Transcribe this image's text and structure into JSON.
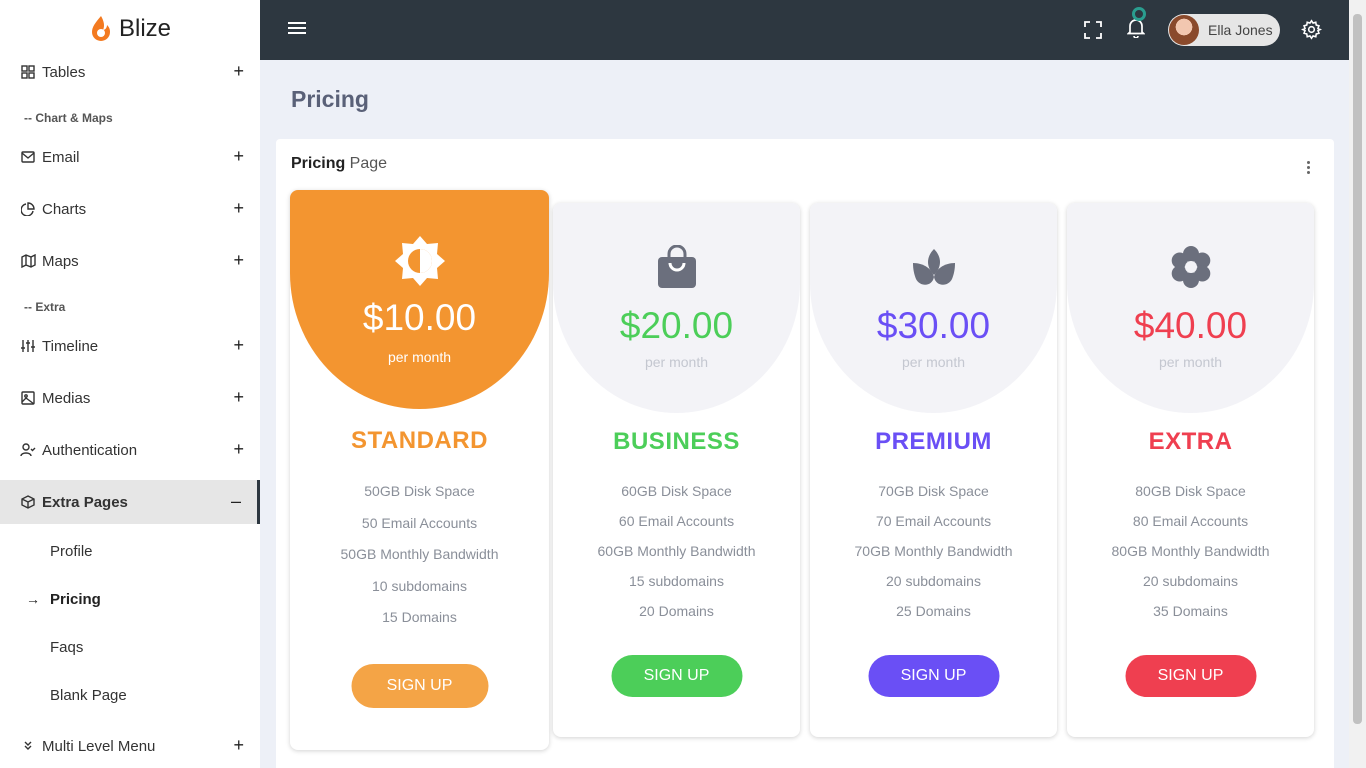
{
  "brand": {
    "name": "Blize"
  },
  "sidebar": {
    "items": [
      {
        "label": "Tables",
        "icon": "grid-icon",
        "toggle": "+"
      },
      {
        "label": "Email",
        "icon": "mail-icon",
        "toggle": "+"
      },
      {
        "label": "Charts",
        "icon": "pie-chart-icon",
        "toggle": "+"
      },
      {
        "label": "Maps",
        "icon": "map-icon",
        "toggle": "+"
      },
      {
        "label": "Timeline",
        "icon": "sliders-icon",
        "toggle": "+"
      },
      {
        "label": "Medias",
        "icon": "image-icon",
        "toggle": "+"
      },
      {
        "label": "Authentication",
        "icon": "user-check-icon",
        "toggle": "+"
      },
      {
        "label": "Extra Pages",
        "icon": "box-icon",
        "toggle": "–"
      },
      {
        "label": "Multi Level Menu",
        "icon": "chevrons-down-icon",
        "toggle": "+"
      }
    ],
    "sections": [
      "-- Chart & Maps",
      "-- Extra"
    ],
    "sub_items": [
      "Profile",
      "Pricing",
      "Faqs",
      "Blank Page"
    ]
  },
  "topbar": {
    "user_name": "Ella Jones"
  },
  "page": {
    "title": "Pricing",
    "card_title_bold": "Pricing",
    "card_title_rest": " Page"
  },
  "plans": [
    {
      "price": "$10.00",
      "per": "per month",
      "name": "STANDARD",
      "color": "#f39530",
      "features": [
        "50GB Disk Space",
        "50 Email Accounts",
        "50GB Monthly Bandwidth",
        "10 subdomains",
        "15 Domains"
      ],
      "button": "SIGN UP",
      "icon": "brightness-icon",
      "featured": true
    },
    {
      "price": "$20.00",
      "per": "per month",
      "name": "BUSINESS",
      "color": "#4cce59",
      "features": [
        "60GB Disk Space",
        "60 Email Accounts",
        "60GB Monthly Bandwidth",
        "15 subdomains",
        "20 Domains"
      ],
      "button": "SIGN UP",
      "icon": "shopping-bag-icon",
      "featured": false
    },
    {
      "price": "$30.00",
      "per": "per month",
      "name": "PREMIUM",
      "color": "#6a4ff5",
      "features": [
        "70GB Disk Space",
        "70 Email Accounts",
        "70GB Monthly Bandwidth",
        "20 subdomains",
        "25 Domains"
      ],
      "button": "SIGN UP",
      "icon": "lotus-icon",
      "featured": false
    },
    {
      "price": "$40.00",
      "per": "per month",
      "name": "EXTRA",
      "color": "#ef3f50",
      "features": [
        "80GB Disk Space",
        "80 Email Accounts",
        "80GB Monthly Bandwidth",
        "20 subdomains",
        "35 Domains"
      ],
      "button": "SIGN UP",
      "icon": "flower-icon",
      "featured": false
    }
  ]
}
